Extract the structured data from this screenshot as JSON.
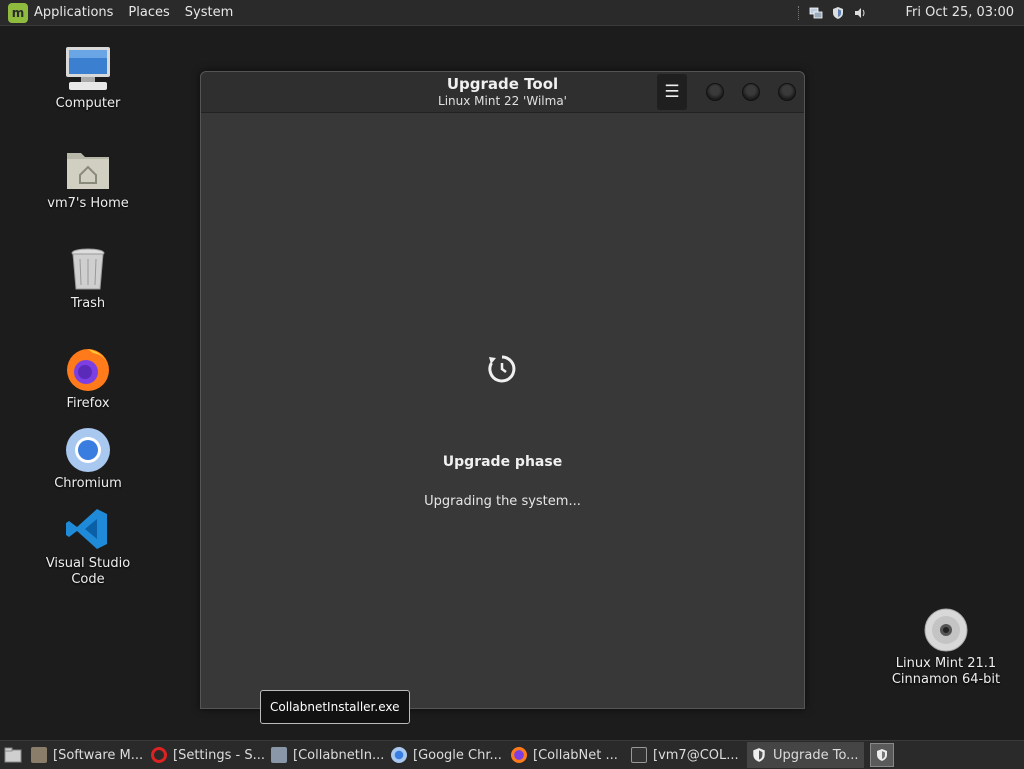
{
  "top_panel": {
    "menus": [
      "Applications",
      "Places",
      "System"
    ],
    "clock": "Fri Oct 25, 03:00"
  },
  "desktop": {
    "icons": [
      {
        "label": "Computer",
        "icon": "computer-icon"
      },
      {
        "label": "vm7's Home",
        "icon": "home-folder-icon"
      },
      {
        "label": "Trash",
        "icon": "trash-icon"
      },
      {
        "label": "Firefox",
        "icon": "firefox-icon"
      },
      {
        "label": "Chromium",
        "icon": "chromium-icon"
      },
      {
        "label": "Visual Studio Code",
        "icon": "vscode-icon"
      }
    ],
    "disc": {
      "line1": "Linux Mint 21.1",
      "line2": "Cinnamon 64-bit",
      "icon": "disc-icon"
    }
  },
  "window": {
    "title": "Upgrade Tool",
    "subtitle": "Linux Mint 22 'Wilma'",
    "phase_title": "Upgrade phase",
    "phase_status": "Upgrading the system..."
  },
  "tooltip": {
    "text": "CollabnetInstaller.exe"
  },
  "taskbar": {
    "items": [
      {
        "label": "[Software M...",
        "icon": "software-manager-icon"
      },
      {
        "label": "[Settings - S...",
        "icon": "opera-icon"
      },
      {
        "label": "[CollabnetIn...",
        "icon": "installer-icon"
      },
      {
        "label": "[Google Chr...",
        "icon": "chrome-icon"
      },
      {
        "label": "[CollabNet ...",
        "icon": "firefox-icon"
      },
      {
        "label": "[vm7@COL...",
        "icon": "terminal-icon"
      },
      {
        "label": "Upgrade To...",
        "icon": "shield-icon"
      }
    ]
  },
  "colors": {
    "accent": "#8fbc3f",
    "panel": "#2a2a2a",
    "window_bg": "#383838"
  }
}
